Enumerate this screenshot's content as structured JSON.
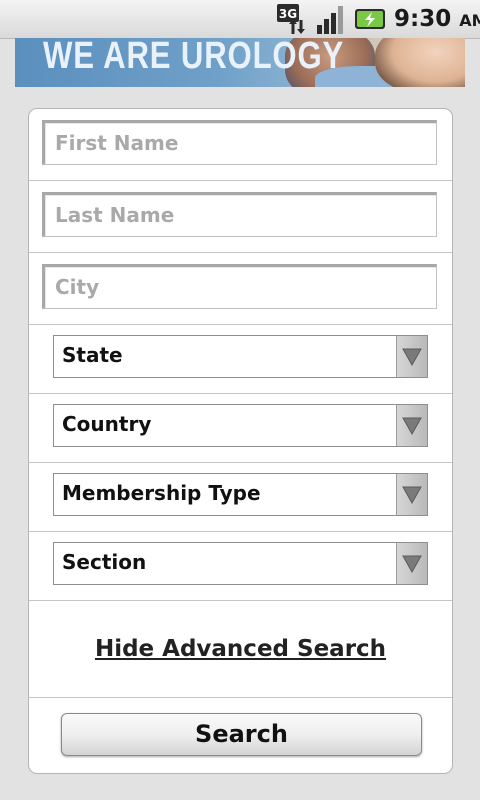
{
  "status_bar": {
    "network": "3G",
    "time": "9:30",
    "ampm": "AM",
    "icons": [
      "3g-data-icon",
      "signal-strength-icon",
      "battery-charging-icon"
    ]
  },
  "banner": {
    "text": "WE ARE UROLOGY"
  },
  "form": {
    "first_name": {
      "placeholder": "First Name",
      "value": ""
    },
    "last_name": {
      "placeholder": "Last Name",
      "value": ""
    },
    "city": {
      "placeholder": "City",
      "value": ""
    },
    "state": {
      "selected": "State"
    },
    "country": {
      "selected": "Country"
    },
    "membership_type": {
      "selected": "Membership Type"
    },
    "section": {
      "selected": "Section"
    },
    "advanced_link": "Hide Advanced Search",
    "search_button": "Search"
  }
}
